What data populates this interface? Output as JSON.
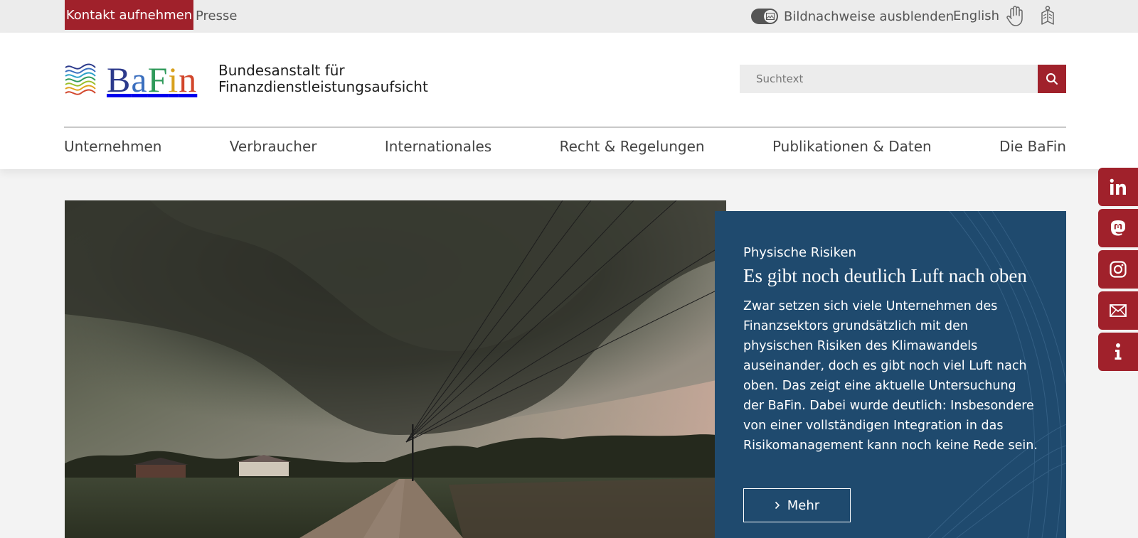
{
  "topbar": {
    "contact_label": "Kontakt aufnehmen",
    "press_label": "Presse",
    "toggle_label": "Bildnachweise ausblenden",
    "language_label": "English",
    "sign_language_icon": "hand-icon",
    "easy_language_icon": "easy-language-icon"
  },
  "header": {
    "logo_text": "BaFin",
    "org_name_line1": "Bundesanstalt für",
    "org_name_line2": "Finanzdienstleistungsaufsicht",
    "search_placeholder": "Suchtext"
  },
  "nav": {
    "items": [
      {
        "label": "Unternehmen"
      },
      {
        "label": "Verbraucher"
      },
      {
        "label": "Internationales"
      },
      {
        "label": "Recht & Regelungen"
      },
      {
        "label": "Publikationen & Daten"
      },
      {
        "label": "Die BaFin"
      }
    ]
  },
  "social": {
    "items": [
      "linkedin-icon",
      "mastodon-icon",
      "instagram-icon",
      "mail-icon",
      "info-icon"
    ]
  },
  "hero": {
    "kicker": "Physische Risiken",
    "headline": "Es gibt noch deutlich Luft nach oben",
    "teaser": "Zwar setzen sich viele Unternehmen des Finanzsektors grundsätzlich mit den physischen Risiken des Klimawandels auseinander, doch es gibt noch viel Luft nach oben. Das zeigt eine aktuelle Untersuchung der BaFin. Dabei wurde deutlich: Insbesondere von einer vollständigen Integration in das Risikomanagement kann noch keine Rede sein.",
    "more_label": "Mehr"
  },
  "colors": {
    "brand_red": "#a0212b",
    "panel_blue": "#1f4a6e",
    "topbar_gray": "#ececec"
  }
}
